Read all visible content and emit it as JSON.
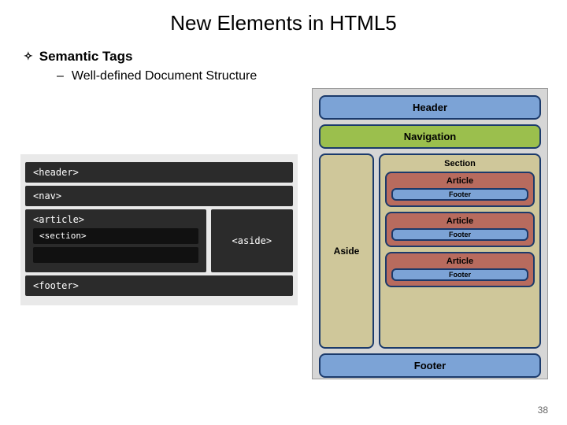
{
  "title": "New Elements in HTML5",
  "bullet1": "Semantic Tags",
  "bullet2": "Well-defined Document Structure",
  "left_diagram": {
    "header": "<header>",
    "nav": "<nav>",
    "article": "<article>",
    "section": "<section>",
    "aside": "<aside>",
    "footer": "<footer>"
  },
  "right_diagram": {
    "header": "Header",
    "nav": "Navigation",
    "aside": "Aside",
    "section": "Section",
    "article": "Article",
    "article_footer": "Footer",
    "footer": "Footer"
  },
  "page_number": "38"
}
